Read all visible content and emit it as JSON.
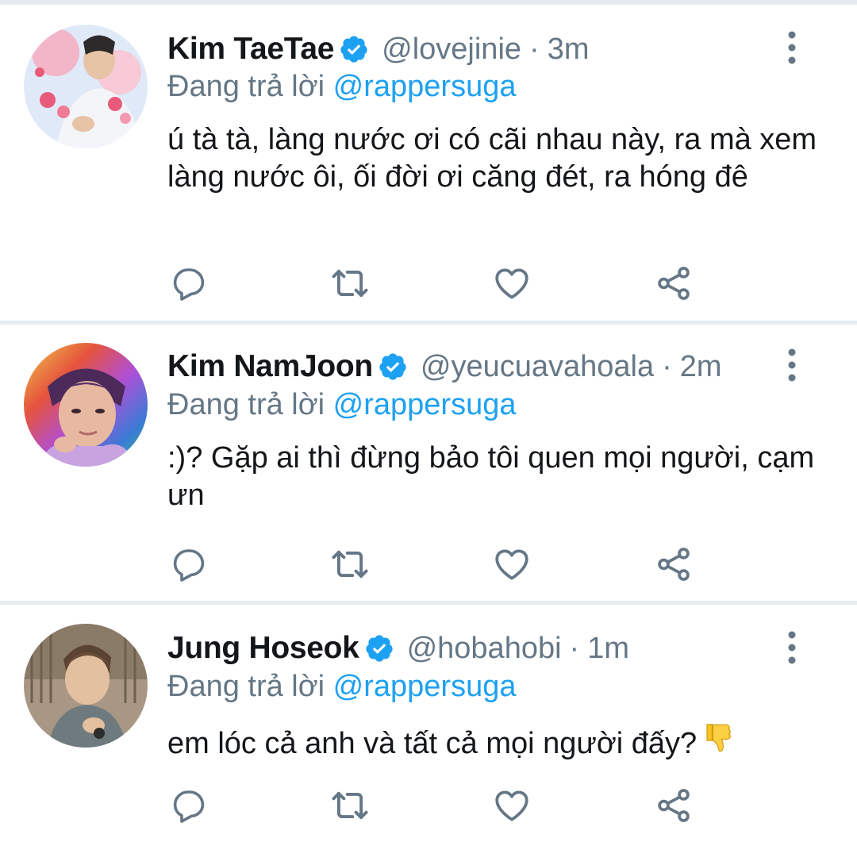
{
  "colors": {
    "accent": "#1da1f2",
    "secondary_text": "#657786",
    "primary_text": "#14171a",
    "divider": "#e6ecf0"
  },
  "tweets": [
    {
      "display_name": "Kim TaeTae",
      "handle": "@lovejinie",
      "separator": "·",
      "time": "3m",
      "replying_prefix": "Đang trả lời",
      "replying_to": "@rappersuga",
      "text": "ú tà tà, làng nước ơi có cãi nhau này, ra mà xem làng nước ôi, ối đời ơi căng đét, ra hóng đê",
      "verified": true
    },
    {
      "display_name": "Kim NamJoon",
      "handle": "@yeucuavahoala",
      "separator": "·",
      "time": "2m",
      "replying_prefix": "Đang trả lời",
      "replying_to": "@rappersuga",
      "text": ":)? Gặp ai thì đừng bảo tôi quen mọi người, cạm ưn",
      "verified": true
    },
    {
      "display_name": "Jung Hoseok",
      "handle": "@hobahobi",
      "separator": "·",
      "time": "1m",
      "replying_prefix": "Đang trả lời",
      "replying_to": "@rappersuga",
      "text": "em lóc cả anh và tất cả mọi người đấy?",
      "trailing_emoji_icon": "thumbs-down-emoji-icon",
      "verified": true
    }
  ],
  "icons": {
    "verified": "verified-badge-icon",
    "more": "more-vertical-icon",
    "reply": "reply-icon",
    "retweet": "retweet-icon",
    "like": "like-heart-icon",
    "share": "share-icon"
  }
}
